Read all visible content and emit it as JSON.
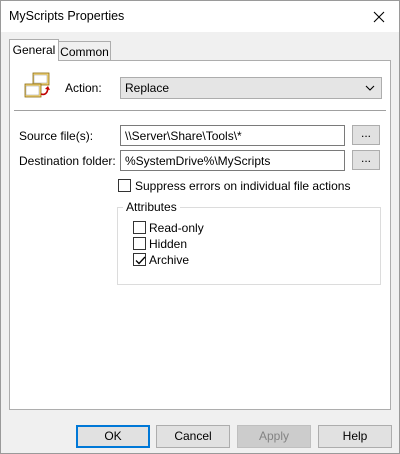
{
  "window": {
    "title": "MyScripts Properties",
    "close_glyph": "✕"
  },
  "tabs": [
    {
      "label": "General",
      "selected": true
    },
    {
      "label": "Common",
      "selected": false
    }
  ],
  "general": {
    "icon": "files-replace-icon",
    "action": {
      "label": "Action:",
      "value": "Replace",
      "arrow": "⌵"
    },
    "source": {
      "label": "Source file(s):",
      "value": "\\\\Server\\Share\\Tools\\*",
      "browse_label": "..."
    },
    "destination": {
      "label": "Destination folder:",
      "value": "%SystemDrive%\\MyScripts",
      "browse_label": "..."
    },
    "suppress_errors": {
      "label": "Suppress errors on individual file actions",
      "checked": false
    },
    "attributes": {
      "title": "Attributes",
      "read_only": {
        "label": "Read-only",
        "checked": false
      },
      "hidden": {
        "label": "Hidden",
        "checked": false
      },
      "archive": {
        "label": "Archive",
        "checked": true
      }
    }
  },
  "buttons": {
    "ok": "OK",
    "cancel": "Cancel",
    "apply": "Apply",
    "help": "Help"
  },
  "colors": {
    "accent": "#0078d7",
    "dialog_bg": "#f0f0f0",
    "panel_bg": "#ffffff"
  }
}
